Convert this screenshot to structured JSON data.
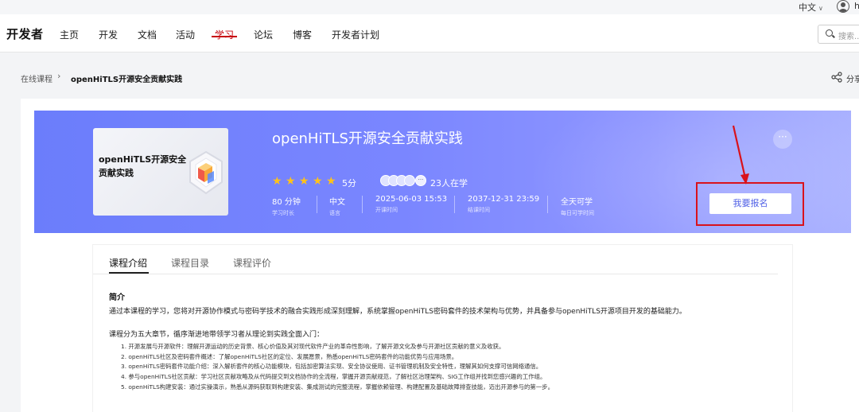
{
  "topbar": {
    "language": "中文",
    "username": "h"
  },
  "nav": {
    "logo": "开发者",
    "items": [
      "主页",
      "开发",
      "文档",
      "活动",
      "学习",
      "论坛",
      "博客",
      "开发者计划"
    ],
    "active_index": 4,
    "search_placeholder": "搜索..."
  },
  "breadcrumb": {
    "home": "在线课程",
    "current": "openHiTLS开源安全贡献实践",
    "share": "分享"
  },
  "course": {
    "thumbnail_text": "openHiTLS开源安全贡献实践",
    "title": "openHiTLS开源安全贡献实践",
    "rating": 5,
    "score_label": "5分",
    "learners": "23人在学",
    "stats": [
      {
        "value": "80 分钟",
        "label": "学习时长"
      },
      {
        "value": "中文",
        "label": "语言"
      },
      {
        "value": "2025-06-03 15:53",
        "label": "开课时间"
      },
      {
        "value": "2037-12-31 23:59",
        "label": "结课时间"
      },
      {
        "value": "全天可学",
        "label": "每日可学时间"
      }
    ],
    "more": "···",
    "enroll": "我要报名"
  },
  "tabs": [
    "课程介绍",
    "课程目录",
    "课程评价"
  ],
  "intro": {
    "heading": "简介",
    "summary": "通过本课程的学习，您将对开源协作模式与密码学技术的融合实践形成深刻理解，系统掌握openHiTLS密码套件的技术架构与优势，并具备参与openHiTLS开源项目开发的基础能力。",
    "chapters_heading": "课程分为五大章节，循序渐进地带领学习者从理论到实践全面入门：",
    "chapters": [
      "1. 开源发展与开源软件：理解开源运动的历史背景、核心价值及其对现代软件产业的革命性影响，了解开源文化及参与开源社区贡献的意义及收获。",
      "2. openHiTLS社区及密码套件概述：了解openHiTLS社区的定位、发展愿景，熟悉openHiTLS密码套件的功能优势与应用场景。",
      "3. openHiTLS密码套件功能介绍：深入解析套件的核心功能模块，包括加密算法实现、安全协议使用、证书管理机制及安全特性，理解其如何支撑可信网络通信。",
      "4. 参与openHiTLS社区贡献：学习社区贡献攻略及从代码提交到文档协作的全流程，掌握开源贡献规范，了解社区治理架构、SIG工作组并找到您感兴趣的工作组。",
      "5. openHiTLS构建安装：通过实操演示，熟悉从源码获取到构建安装、集成测试的完整流程，掌握依赖管理、构建配置及基础故障排查技能，迈出开源参与的第一步。"
    ]
  }
}
